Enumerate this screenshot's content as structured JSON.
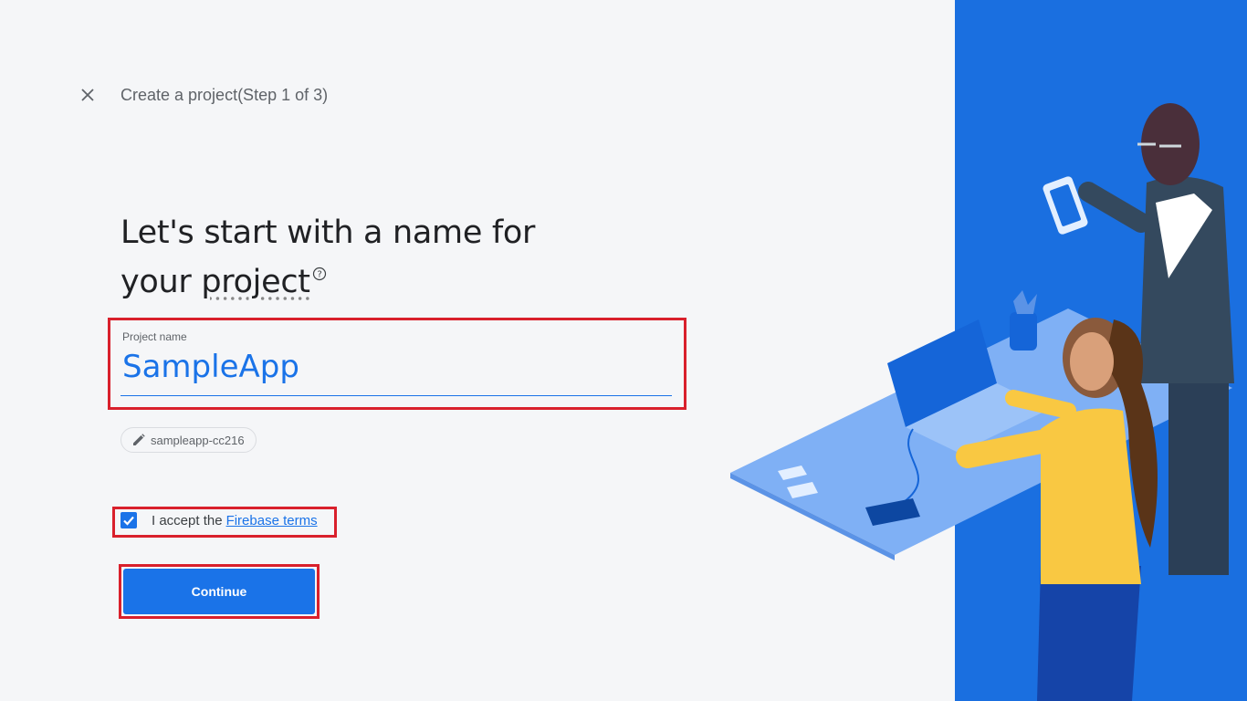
{
  "header": {
    "title": "Create a project(Step 1 of 3)"
  },
  "headline": {
    "line1": "Let's start with a name for",
    "line2_prefix": "your ",
    "line2_link": "project",
    "help_glyph": "?"
  },
  "project_name_field": {
    "label": "Project name",
    "value": "SampleApp"
  },
  "project_id_chip": {
    "label": "sampleapp-cc216",
    "icon": "pencil-icon"
  },
  "terms": {
    "checked": true,
    "text": "I accept the",
    "link_label": "Firebase terms"
  },
  "actions": {
    "continue_label": "Continue"
  },
  "colors": {
    "accent": "#1a73e8",
    "highlight": "#d9202c",
    "panel_blue": "#1a73e8"
  }
}
